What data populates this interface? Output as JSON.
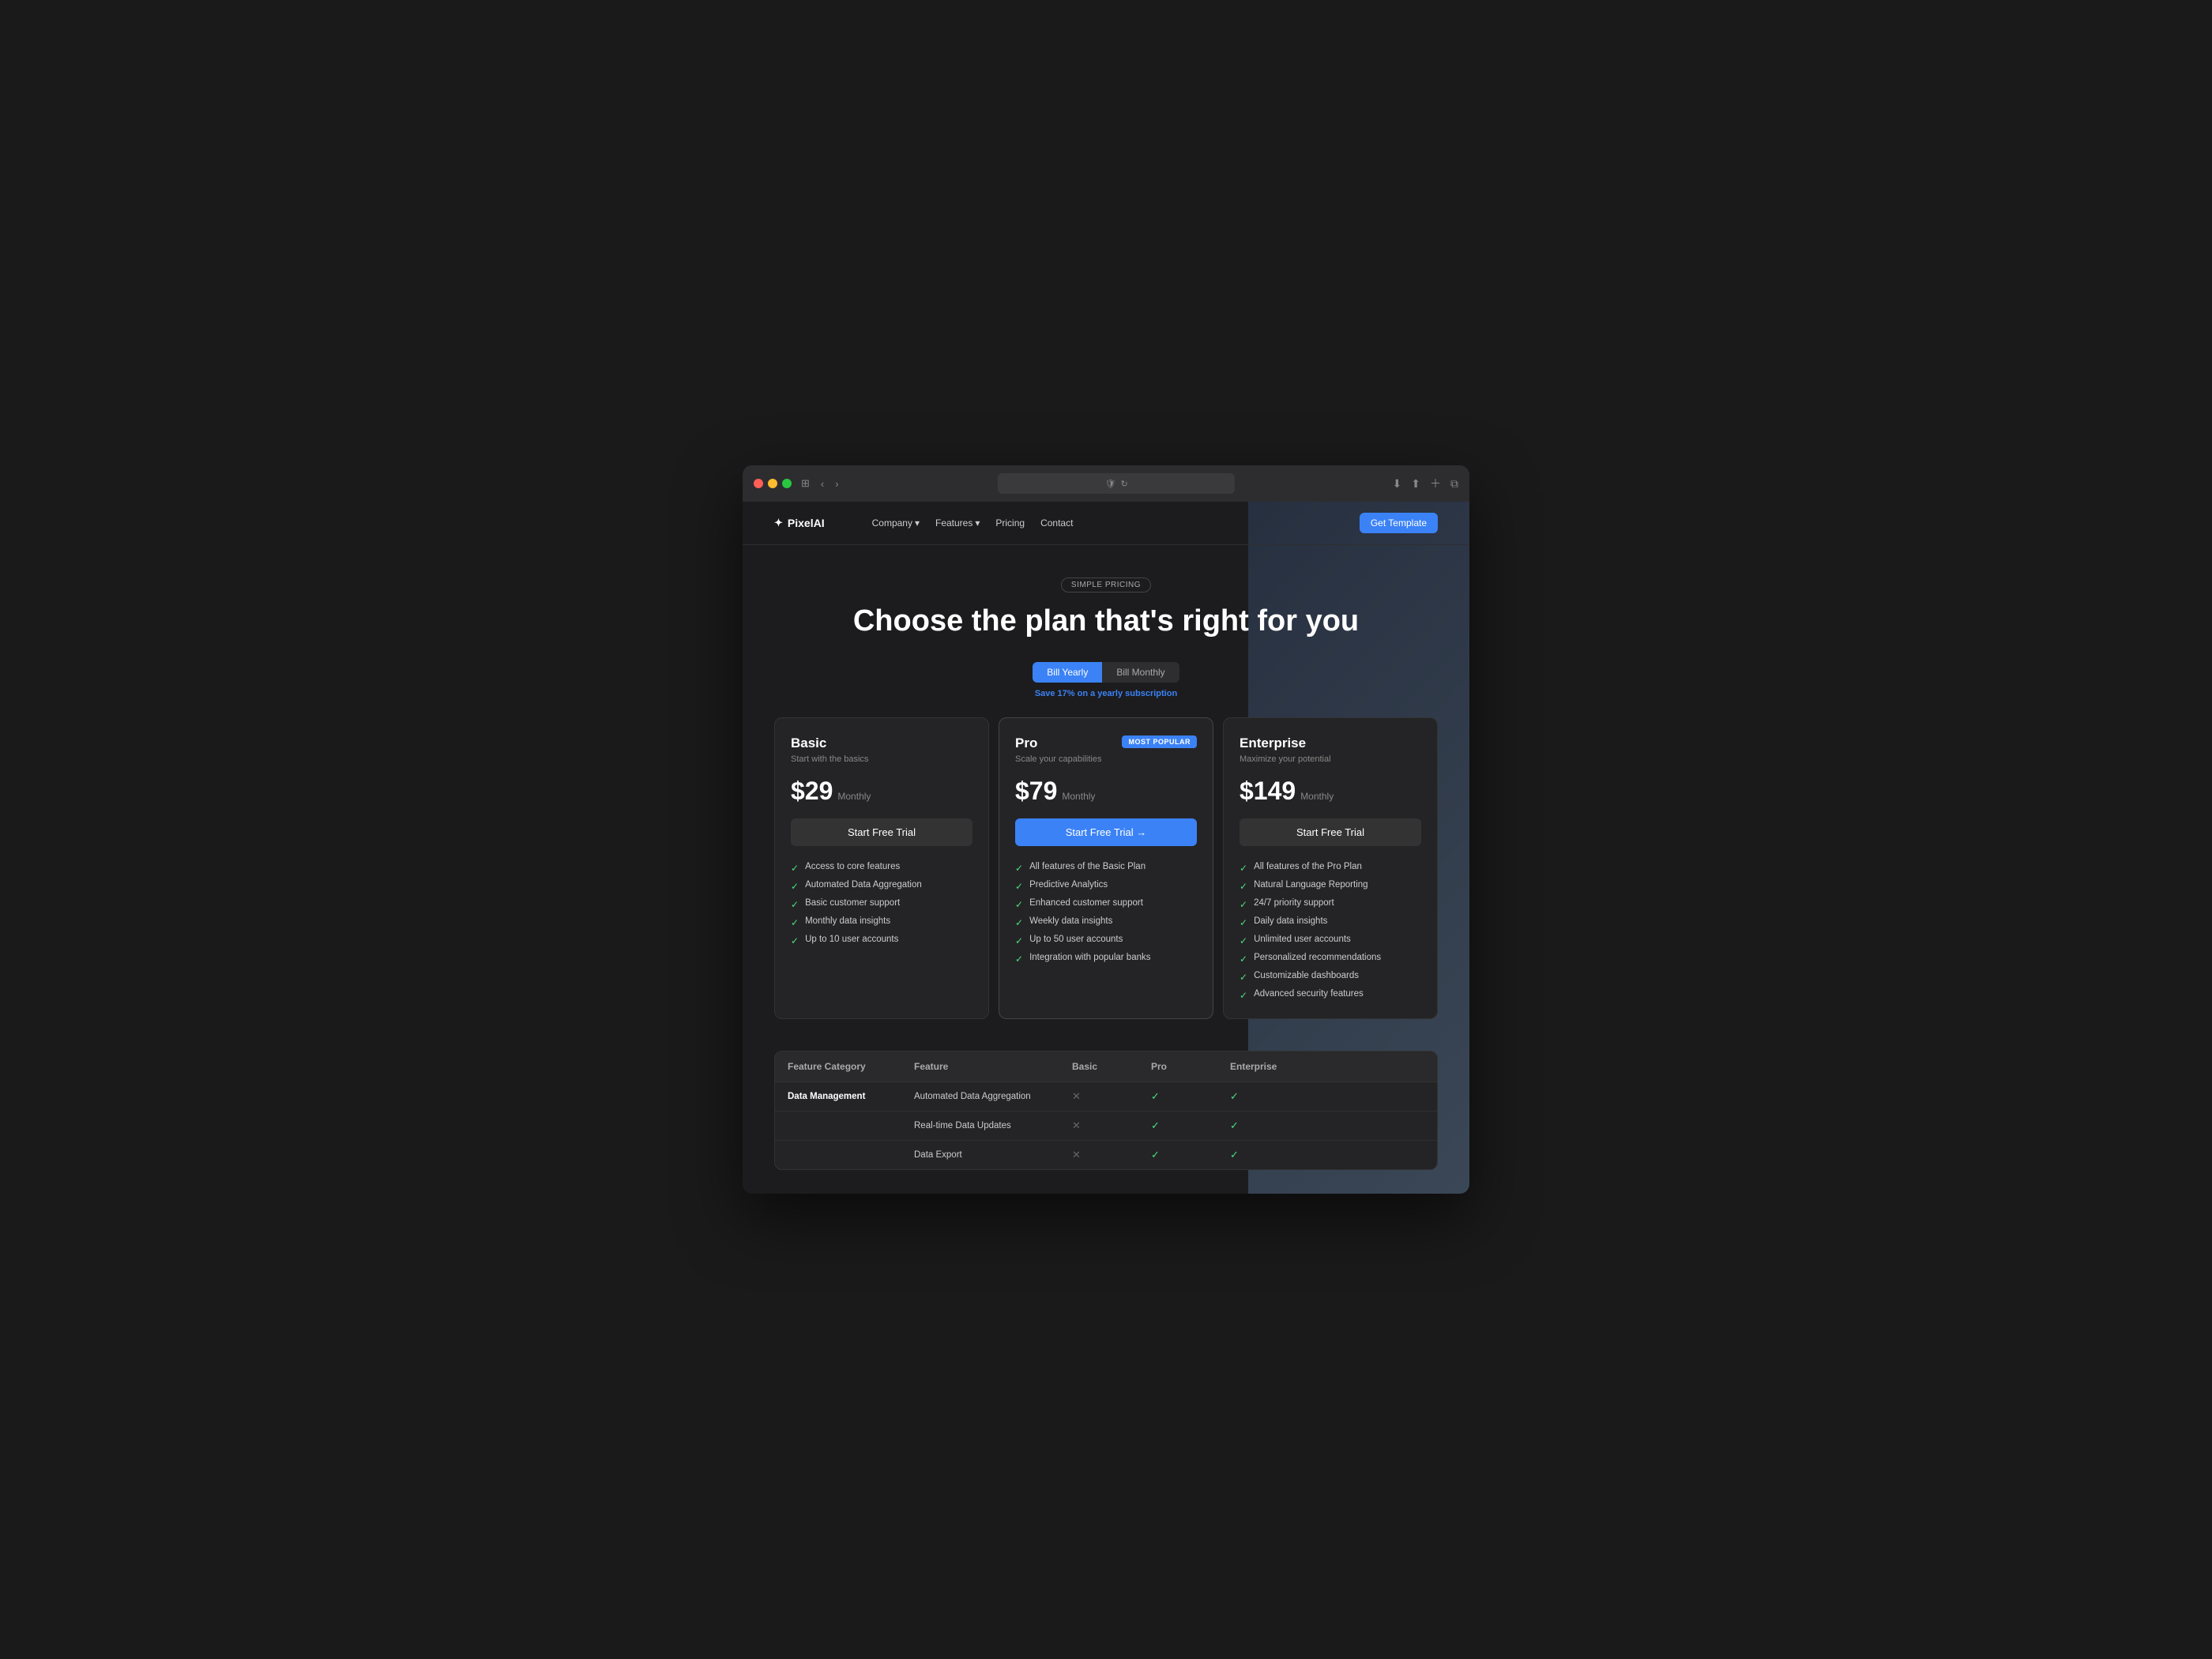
{
  "browser": {
    "address": ""
  },
  "nav": {
    "logo": "PixelAI",
    "logo_icon": "✦",
    "links": [
      {
        "label": "Company",
        "has_dropdown": true
      },
      {
        "label": "Features",
        "has_dropdown": true
      },
      {
        "label": "Pricing",
        "has_dropdown": false
      },
      {
        "label": "Contact",
        "has_dropdown": false
      }
    ],
    "cta": "Get Template"
  },
  "pricing": {
    "badge": "SIMPLE PRICING",
    "title": "Choose the plan that's right for you",
    "billing": {
      "yearly_label": "Bill Yearly",
      "monthly_label": "Bill Monthly",
      "save_text": "Save 17%",
      "save_suffix": " on a yearly subscription"
    },
    "plans": [
      {
        "id": "basic",
        "name": "Basic",
        "description": "Start with the basics",
        "price": "$29",
        "period": "Monthly",
        "cta": "Start Free Trial",
        "popular": false,
        "features": [
          "Access to core features",
          "Automated Data Aggregation",
          "Basic customer support",
          "Monthly data insights",
          "Up to 10 user accounts"
        ]
      },
      {
        "id": "pro",
        "name": "Pro",
        "description": "Scale your capabilities",
        "price": "$79",
        "period": "Monthly",
        "cta": "Start Free Trial →",
        "popular": true,
        "popular_label": "MOST POPULAR",
        "features": [
          "All features of the Basic Plan",
          "Predictive Analytics",
          "Enhanced customer support",
          "Weekly data insights",
          "Up to 50 user accounts",
          "Integration with popular banks"
        ]
      },
      {
        "id": "enterprise",
        "name": "Enterprise",
        "description": "Maximize your potential",
        "price": "$149",
        "period": "Monthly",
        "cta": "Start Free Trial",
        "popular": false,
        "features": [
          "All features of the Pro Plan",
          "Natural Language Reporting",
          "24/7 priority support",
          "Daily data insights",
          "Unlimited user accounts",
          "Personalized recommendations",
          "Customizable dashboards",
          "Advanced security features"
        ]
      }
    ]
  },
  "comparison": {
    "headers": [
      "Feature Category",
      "Feature",
      "Basic",
      "Pro",
      "Enterprise"
    ],
    "rows": [
      {
        "category": "Data Management",
        "feature": "Automated Data Aggregation",
        "basic": "cross",
        "pro": "check",
        "enterprise": "check"
      },
      {
        "category": "",
        "feature": "Real-time Data Updates",
        "basic": "cross",
        "pro": "check",
        "enterprise": "check"
      },
      {
        "category": "",
        "feature": "Data Export",
        "basic": "cross",
        "pro": "check",
        "enterprise": "check"
      }
    ]
  }
}
